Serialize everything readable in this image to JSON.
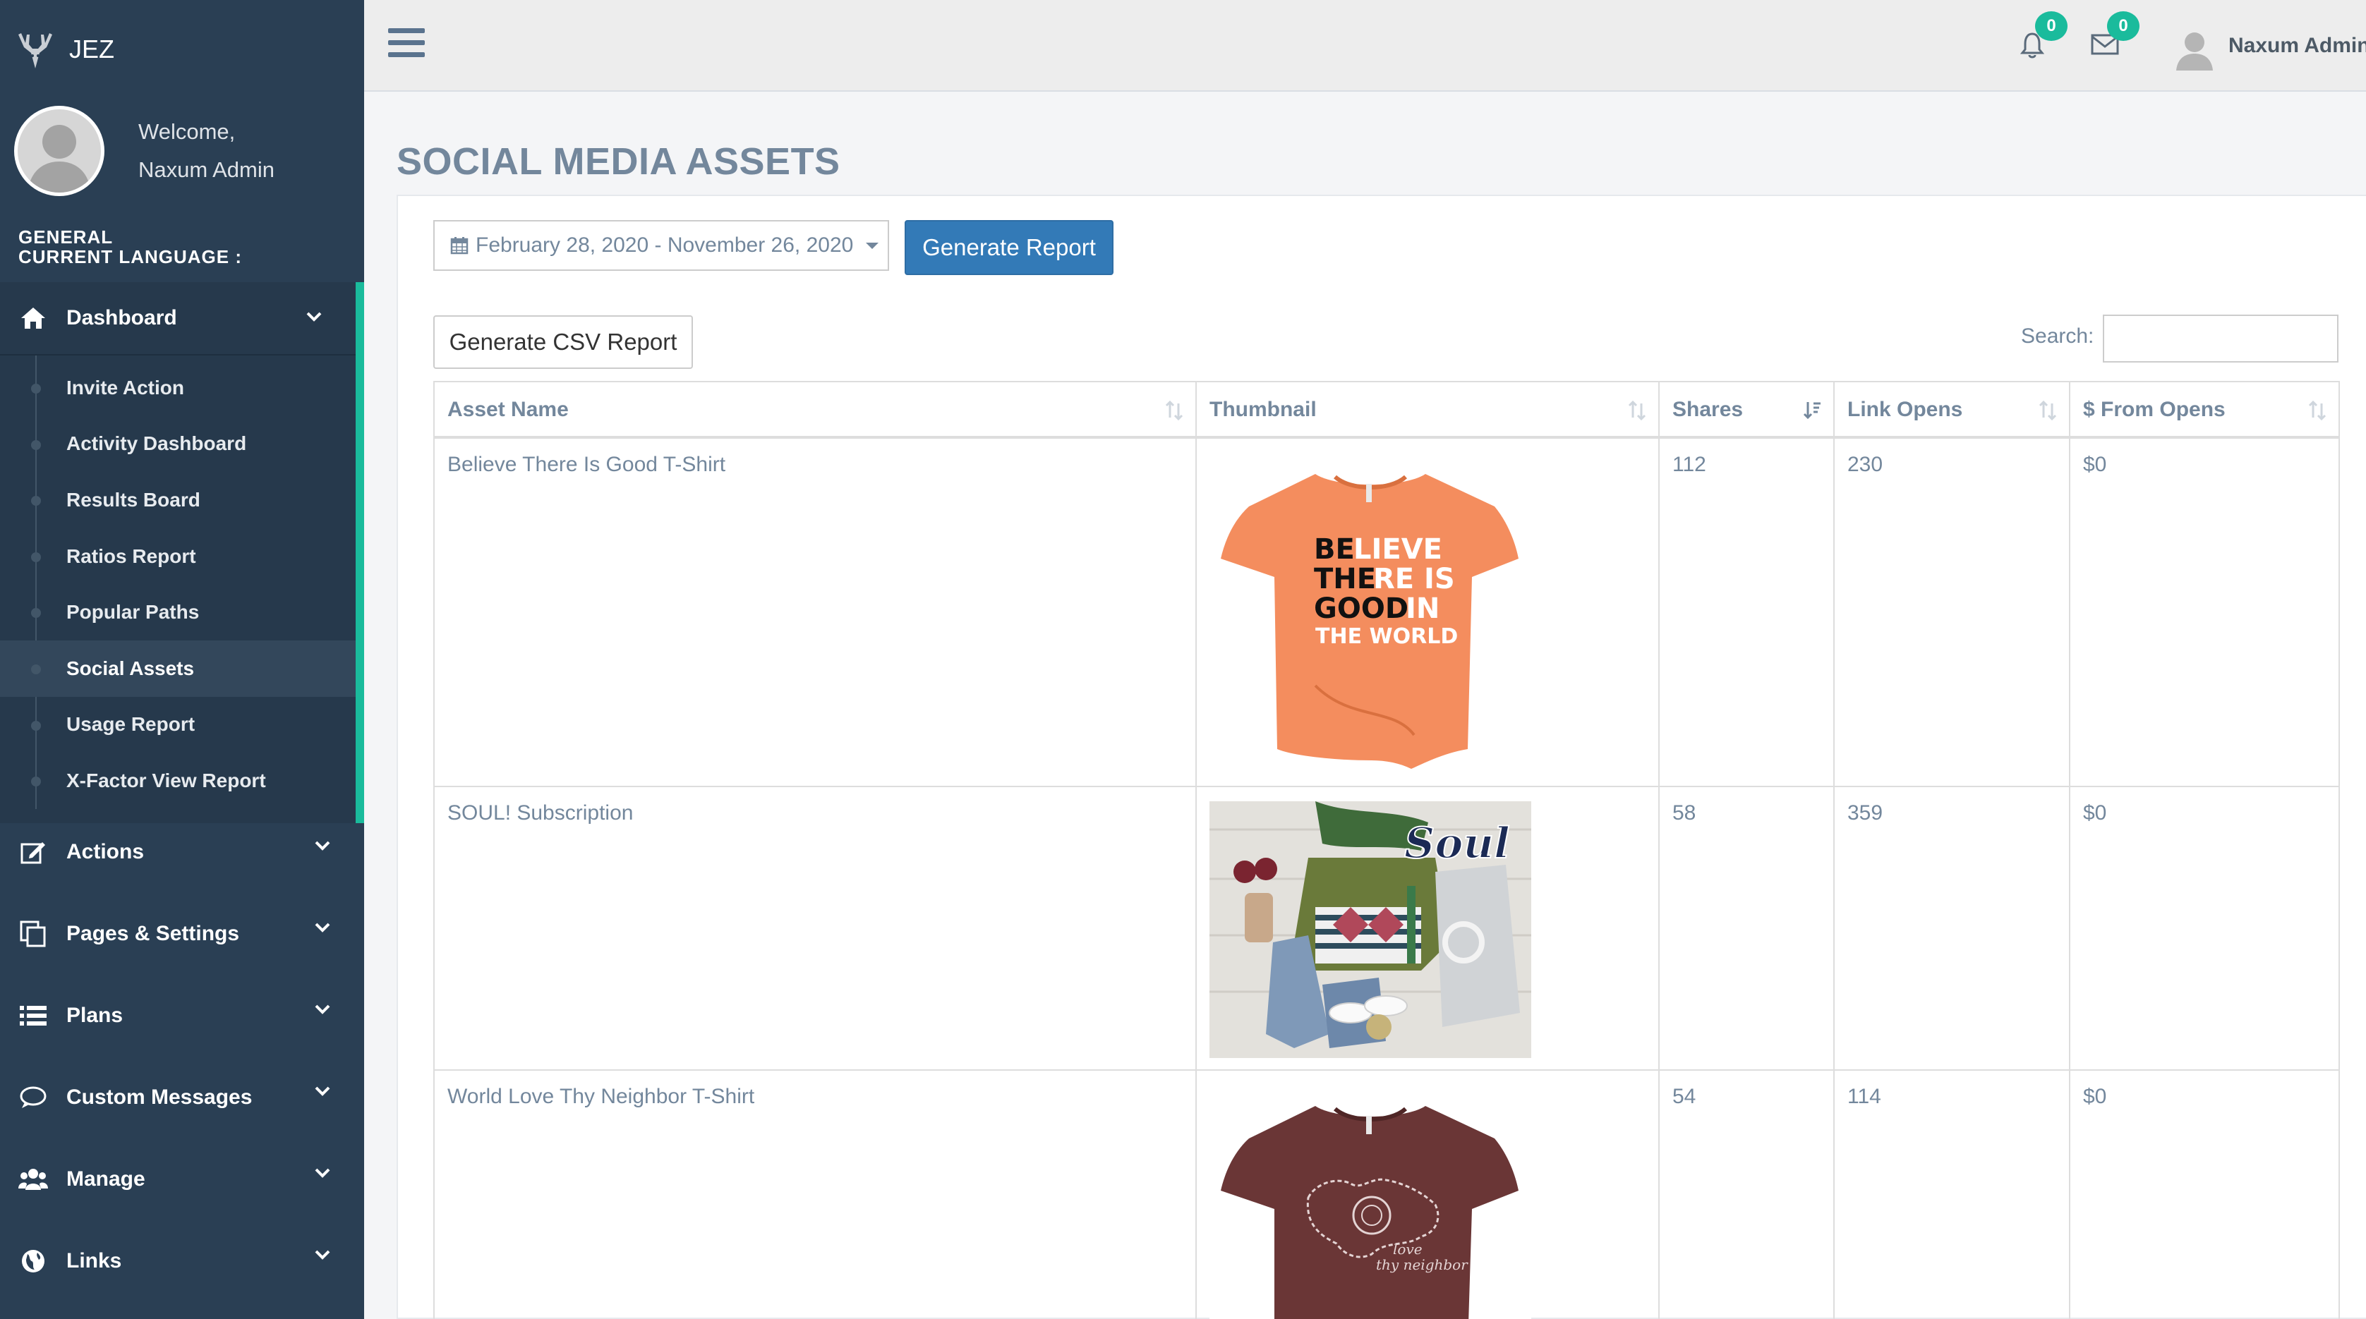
{
  "brand": {
    "name": "JEZ"
  },
  "profile": {
    "welcome": "Welcome,",
    "name": "Naxum Admin"
  },
  "sidebar": {
    "section_line1": "GENERAL",
    "section_line2": "CURRENT LANGUAGE :",
    "dashboard": {
      "label": "Dashboard",
      "icon": "home-icon",
      "items": [
        {
          "label": "Invite Action"
        },
        {
          "label": "Activity Dashboard"
        },
        {
          "label": "Results Board"
        },
        {
          "label": "Ratios Report"
        },
        {
          "label": "Popular Paths"
        },
        {
          "label": "Social Assets",
          "active": true
        },
        {
          "label": "Usage Report"
        },
        {
          "label": "X-Factor View Report"
        }
      ]
    },
    "menus": [
      {
        "label": "Actions",
        "icon": "edit-icon"
      },
      {
        "label": "Pages & Settings",
        "icon": "copy-icon"
      },
      {
        "label": "Plans",
        "icon": "list-icon"
      },
      {
        "label": "Custom Messages",
        "icon": "comment-icon"
      },
      {
        "label": "Manage",
        "icon": "users-icon"
      },
      {
        "label": "Links",
        "icon": "globe-icon"
      }
    ]
  },
  "topbar": {
    "notifications_count": "0",
    "messages_count": "0",
    "user_name": "Naxum Admin"
  },
  "page": {
    "title": "SOCIAL MEDIA ASSETS",
    "date_range": "February 28, 2020 - November 26, 2020",
    "generate_report": "Generate Report",
    "generate_csv": "Generate CSV Report",
    "search_label": "Search:",
    "search_value": ""
  },
  "table": {
    "headers": [
      "Asset Name",
      "Thumbnail",
      "Shares",
      "Link Opens",
      "$ From Opens"
    ],
    "rows": [
      {
        "name": "Believe There Is Good T-Shirt",
        "thumbnail": "orange-tshirt-believe",
        "shares": "112",
        "opens": "230",
        "from_opens": "$0",
        "shirt_text": [
          "BE",
          "LIEVE",
          "THE",
          "RE IS",
          "GOOD",
          "IN",
          "THE WORLD"
        ]
      },
      {
        "name": "SOUL! Subscription",
        "thumbnail": "soul-flatlay",
        "shares": "58",
        "opens": "359",
        "from_opens": "$0",
        "logo_text": "Soul"
      },
      {
        "name": "World Love Thy Neighbor T-Shirt",
        "thumbnail": "maroon-tshirt-world",
        "shares": "54",
        "opens": "114",
        "from_opens": "$0",
        "shirt_text": [
          "love",
          "thy neighbor"
        ]
      }
    ]
  }
}
